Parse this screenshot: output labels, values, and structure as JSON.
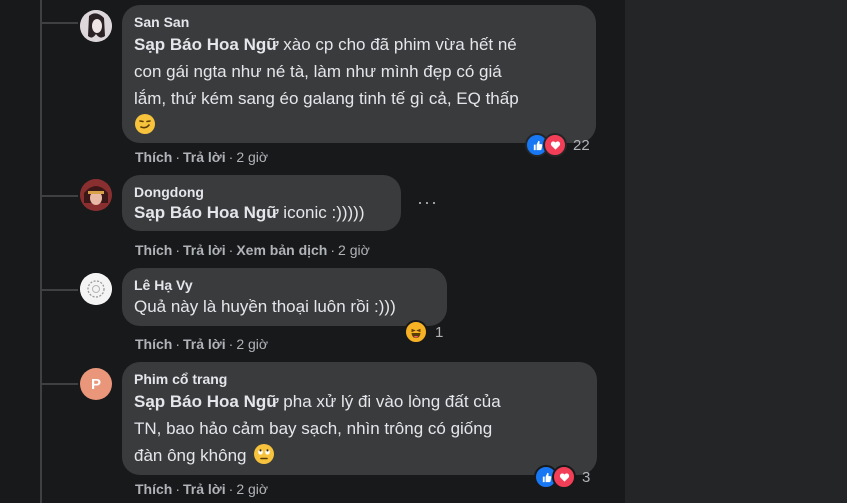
{
  "comments": [
    {
      "author": "San San",
      "mention": "Sạp Báo Hoa Ngữ",
      "lines": [
        " xào cp cho đã phim vừa hết né",
        "con gái ngta như né tà, làm như mình đẹp có giá",
        "lắm, thứ kém sang éo galang tinh tế gì cả, EQ thấp"
      ],
      "emoji": "smirk-emoji",
      "actions": {
        "like": "Thích",
        "reply": "Trả lời",
        "time": "2 giờ"
      },
      "reactions": {
        "icons": [
          "like-icon",
          "love-icon"
        ],
        "count": "22"
      }
    },
    {
      "author": "Dongdong",
      "mention": "Sạp Báo Hoa Ngữ",
      "text": " iconic :)))))",
      "actions": {
        "like": "Thích",
        "reply": "Trả lời",
        "translate": "Xem bản dịch",
        "time": "2 giờ"
      },
      "more": "···"
    },
    {
      "author": "Lê Hạ Vy",
      "text": "Quả này là huyền thoại luôn rồi :)))",
      "actions": {
        "like": "Thích",
        "reply": "Trả lời",
        "time": "2 giờ"
      },
      "reactions": {
        "icons": [
          "haha-icon"
        ],
        "count": "1"
      }
    },
    {
      "author": "Phim cổ trang",
      "avatar_letter": "P",
      "mention": "Sạp Báo Hoa Ngữ",
      "lines": [
        " pha xử lý đi vào lòng đất của",
        "TN, bao hảo cảm bay sạch, nhìn trông có giống",
        "đàn ông không"
      ],
      "emoji": "rolling-eyes-emoji",
      "actions": {
        "like": "Thích",
        "reply": "Trả lời",
        "time": "2 giờ"
      },
      "reactions": {
        "icons": [
          "like-icon",
          "love-icon"
        ],
        "count": "3"
      }
    }
  ],
  "colors": {
    "background": "#18191a",
    "bubble": "#3a3b3c",
    "text": "#e4e6eb",
    "secondary": "#b0b3b8",
    "like": "#1877f2",
    "love": "#f33e58",
    "haha": "#f7b125",
    "avatar_p": "#e9967a"
  }
}
